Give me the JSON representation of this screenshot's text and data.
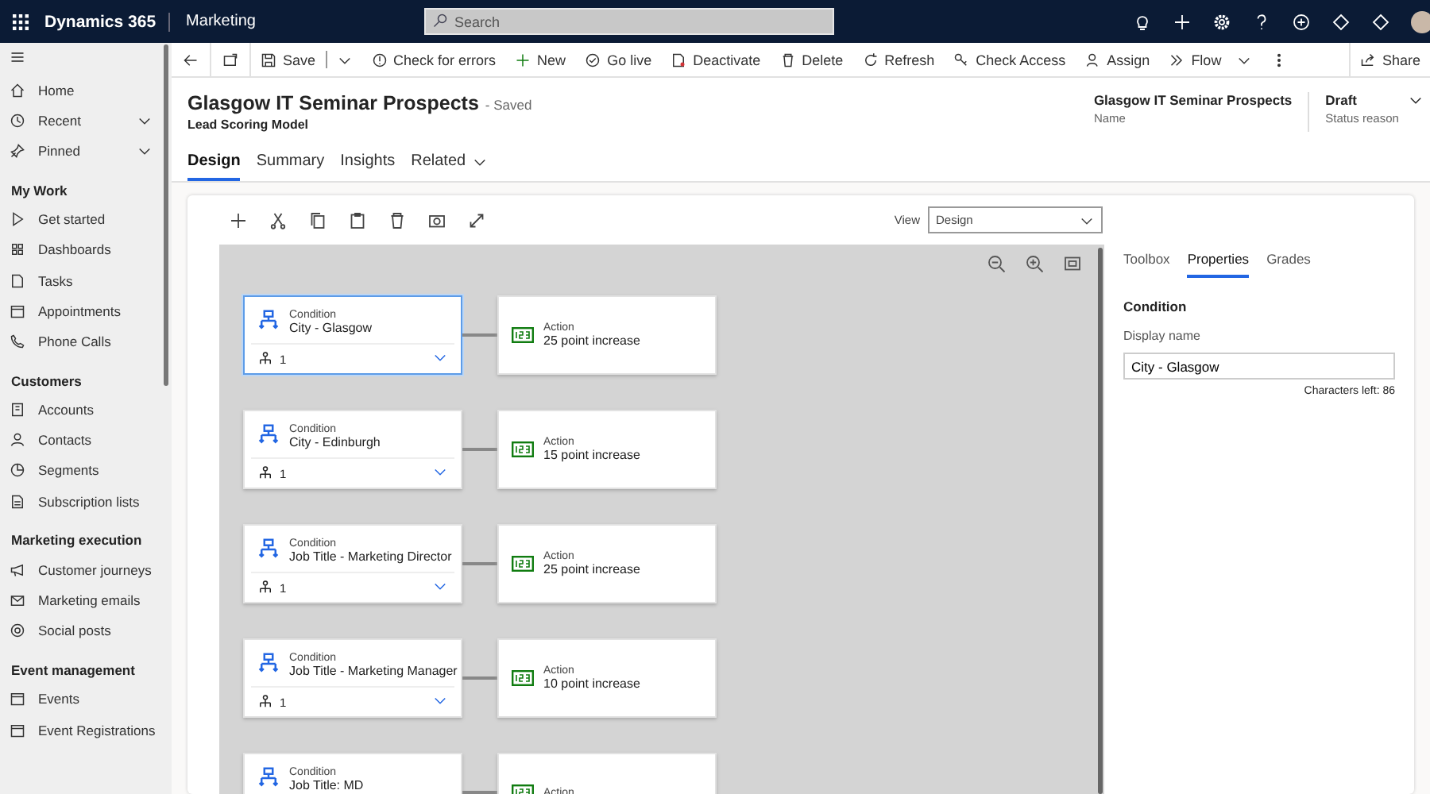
{
  "top_bar": {
    "app_name": "Dynamics 365",
    "area": "Marketing",
    "search": {
      "placeholder": "Search"
    }
  },
  "sidebar": {
    "top_items": [
      {
        "label": "Home",
        "expandable": false
      },
      {
        "label": "Recent",
        "expandable": true
      },
      {
        "label": "Pinned",
        "expandable": true
      }
    ],
    "groups": [
      {
        "title": "My Work",
        "items": [
          "Get started",
          "Dashboards",
          "Tasks",
          "Appointments",
          "Phone Calls"
        ]
      },
      {
        "title": "Customers",
        "items": [
          "Accounts",
          "Contacts",
          "Segments",
          "Subscription lists"
        ]
      },
      {
        "title": "Marketing execution",
        "items": [
          "Customer journeys",
          "Marketing emails",
          "Social posts"
        ]
      },
      {
        "title": "Event management",
        "items": [
          "Events",
          "Event Registrations"
        ]
      }
    ]
  },
  "command_bar": {
    "commands": [
      {
        "label": "Save",
        "kind": "split"
      },
      {
        "label": "Check for errors",
        "kind": "button"
      },
      {
        "label": "New",
        "kind": "button"
      },
      {
        "label": "Go live",
        "kind": "button"
      },
      {
        "label": "Deactivate",
        "kind": "button"
      },
      {
        "label": "Delete",
        "kind": "button"
      },
      {
        "label": "Refresh",
        "kind": "button"
      },
      {
        "label": "Check Access",
        "kind": "button"
      },
      {
        "label": "Assign",
        "kind": "button"
      },
      {
        "label": "Flow",
        "kind": "dropdown"
      }
    ],
    "share": "Share"
  },
  "record": {
    "title": "Glasgow IT Seminar Prospects",
    "save_state": "- Saved",
    "entity": "Lead Scoring Model",
    "fields": [
      {
        "value": "Glasgow IT Seminar Prospects",
        "label": "Name"
      },
      {
        "value": "Draft",
        "label": "Status reason"
      }
    ]
  },
  "tabs": [
    {
      "label": "Design",
      "selected": true,
      "dropdown": false
    },
    {
      "label": "Summary",
      "selected": false,
      "dropdown": false
    },
    {
      "label": "Insights",
      "selected": false,
      "dropdown": false
    },
    {
      "label": "Related",
      "selected": false,
      "dropdown": true
    }
  ],
  "designer": {
    "view": {
      "label": "View",
      "value": "Design"
    },
    "rows": [
      {
        "condition": {
          "label": "Condition",
          "name": "City - Glasgow",
          "count": "1",
          "selected": true
        },
        "action": {
          "label": "Action",
          "value": "25 point increase"
        }
      },
      {
        "condition": {
          "label": "Condition",
          "name": "City - Edinburgh",
          "count": "1",
          "selected": false
        },
        "action": {
          "label": "Action",
          "value": "15 point increase"
        }
      },
      {
        "condition": {
          "label": "Condition",
          "name": "Job Title - Marketing Director",
          "count": "1",
          "selected": false
        },
        "action": {
          "label": "Action",
          "value": "25 point increase"
        }
      },
      {
        "condition": {
          "label": "Condition",
          "name": "Job Title - Marketing Manager",
          "count": "1",
          "selected": false
        },
        "action": {
          "label": "Action",
          "value": "10 point increase"
        }
      },
      {
        "condition": {
          "label": "Condition",
          "name": "Job Title: MD"
        },
        "action": {
          "label": "Action"
        }
      }
    ]
  },
  "properties_panel": {
    "tabs": [
      {
        "label": "Toolbox",
        "selected": false
      },
      {
        "label": "Properties",
        "selected": true
      },
      {
        "label": "Grades",
        "selected": false
      }
    ],
    "heading": "Condition",
    "field_label": "Display name",
    "field_value": "City - Glasgow",
    "counter": "Characters left: 86"
  }
}
